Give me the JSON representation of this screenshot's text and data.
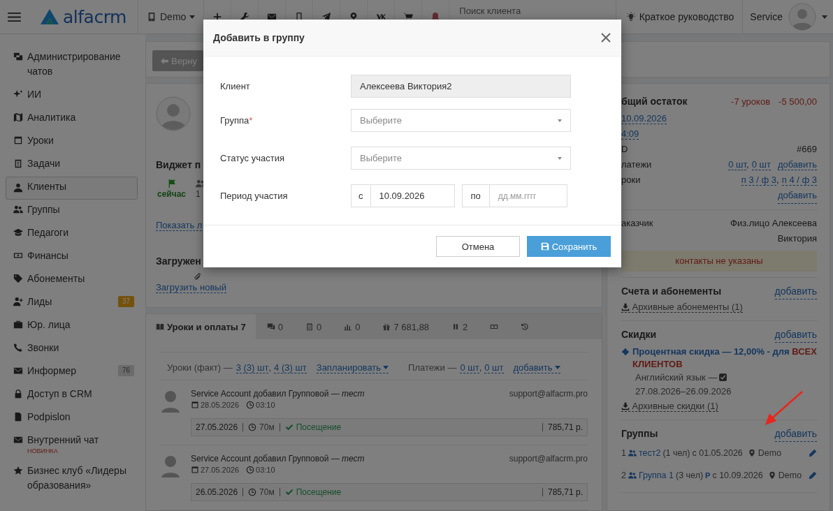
{
  "topbar": {
    "logo": "alfacrm",
    "branch": "Demo",
    "search_placeholder": "Поиск клиента",
    "guide": "Краткое руководство",
    "user": "Service"
  },
  "sidebar": {
    "items": [
      {
        "label": "Администрирование чатов",
        "selected": false
      },
      {
        "label": "ИИ",
        "selected": false
      },
      {
        "label": "Аналитика",
        "selected": false
      },
      {
        "label": "Уроки",
        "selected": false
      },
      {
        "label": "Задачи",
        "selected": false
      },
      {
        "label": "Клиенты",
        "selected": true
      },
      {
        "label": "Группы",
        "selected": false
      },
      {
        "label": "Педагоги",
        "selected": false
      },
      {
        "label": "Финансы",
        "selected": false
      },
      {
        "label": "Абонементы",
        "selected": false
      },
      {
        "label": "Лиды",
        "selected": false,
        "badge": "37",
        "color": "#74520c"
      },
      {
        "label": "Юр. лица",
        "selected": false
      },
      {
        "label": "Звонки",
        "selected": false
      },
      {
        "label": "Информер",
        "selected": false,
        "badge": "76",
        "color": "#6b6b6b"
      },
      {
        "label": "Доступ в CRM",
        "selected": false
      },
      {
        "label": "Podpislon",
        "selected": false
      },
      {
        "label": "Внутренний чат",
        "selected": false,
        "note": "НОВИНКА"
      },
      {
        "label": "Бизнес клуб «Лидеры образования»",
        "selected": false
      }
    ]
  },
  "toolbar": {
    "back_button": "Верну"
  },
  "profile": {
    "widget_title": "Виджет п",
    "widget_status": "сейчас",
    "widget_count": "1",
    "show_link": "Показать л",
    "files_title": "Загружен",
    "upload_link": "Загрузить новый"
  },
  "tabs": [
    {
      "label": "Уроки и оплаты 7",
      "selected": true
    },
    {
      "label": "0",
      "selected": false
    },
    {
      "label": "0",
      "selected": false
    },
    {
      "label": "0",
      "selected": false
    },
    {
      "label": "7 681,88",
      "selected": false
    },
    {
      "label": "2",
      "selected": false
    },
    {
      "selected": false
    },
    {
      "selected": false
    }
  ],
  "summary": {
    "lessons_label": "Уроки (факт) —",
    "lessons_links": [
      {
        "text": "3 (3) шт",
        "after": ","
      },
      {
        "text": "4 (3) шт"
      }
    ],
    "plan": "Запланировать",
    "payments_label": "Платежи —",
    "payments_links": [
      {
        "text": "0 шт",
        "after": ","
      },
      {
        "text": "0 шт"
      }
    ],
    "add": "добавить"
  },
  "entries": [
    {
      "text": "Service Account добавил Групповой — *тест*",
      "date": "28.05.2026",
      "time": "03:10",
      "email": "support@alfacrm.pro",
      "lesson_date": "27.05.2026",
      "duration": "70м",
      "status": "Посещение",
      "amount": "785,71 р."
    },
    {
      "text": "Service Account добавил Групповой — *тест*",
      "date": "27.05.2026",
      "time": "03:10",
      "email": "support@alfacrm.pro",
      "lesson_date": "26.05.2026",
      "duration": "70м",
      "status": "Посещение",
      "amount": "785,71 р."
    }
  ],
  "panel": {
    "balance_title": "бщий остаток",
    "balance_lessons": "-7 уроков",
    "balance_sum": "-5 500,00",
    "date_link": "10.09.2026",
    "time_link": "4:09",
    "id_label": "D",
    "id_value": "#669",
    "payments_label": "латежи",
    "payments_links": [
      {
        "text": "0 шт",
        "after": ","
      },
      {
        "text": "0 шт"
      }
    ],
    "payments_add": "добавить",
    "lessons_label": "роки",
    "lessons_links": [
      {
        "text": "п 3 / ф 3",
        "after": ","
      },
      {
        "text": "п 4 / ф 3"
      }
    ],
    "lessons_add": "добавить",
    "customer_label": "аказчик",
    "customer": "Физ.лицо Алексеева Виктория",
    "contacts_warning": "контакты не указаны",
    "accounts_title": "Счета и абонементы",
    "accounts_add": "добавить",
    "archived_subscriptions": "Архивные абонементы (1)",
    "discounts_title": "Скидки",
    "discounts_add": "добавить",
    "discount": {
      "name": "Процентная скидка — 12,00% - для",
      "scope": "ВСЕХ КЛИЕНТОВ",
      "subject": "Английский язык —",
      "checked": true,
      "period": "27.08.2026–26.09.2026"
    },
    "archived_discounts": "Архивные скидки (1)",
    "groups_title": "Группы",
    "groups_add": "добавить",
    "groups": [
      {
        "index": "1",
        "name": "тест2",
        "members": "(1 чел)",
        "since": "с 01.05.2026",
        "location": "Demo"
      },
      {
        "index": "2",
        "name": "Группа 1",
        "members": "(3 чел)",
        "mark": "Р",
        "since": "с 10.09.2026",
        "location": "Demo"
      }
    ]
  },
  "modal": {
    "title": "Добавить в группу",
    "fields": [
      {
        "kind": "readonly",
        "label": "Клиент",
        "value": "Алексеева Виктория2"
      },
      {
        "kind": "select",
        "label": "Группа",
        "required_mark": "*",
        "placeholder": "Выберите"
      },
      {
        "kind": "select",
        "label": "Статус участия",
        "placeholder": "Выберите"
      },
      {
        "kind": "period",
        "label": "Период участия",
        "from_label": "с",
        "from_value": "10.09.2026",
        "to_label": "по",
        "to_placeholder": "дд.мм.гггг"
      }
    ],
    "cancel": "Отмена",
    "save": "Сохранить"
  }
}
